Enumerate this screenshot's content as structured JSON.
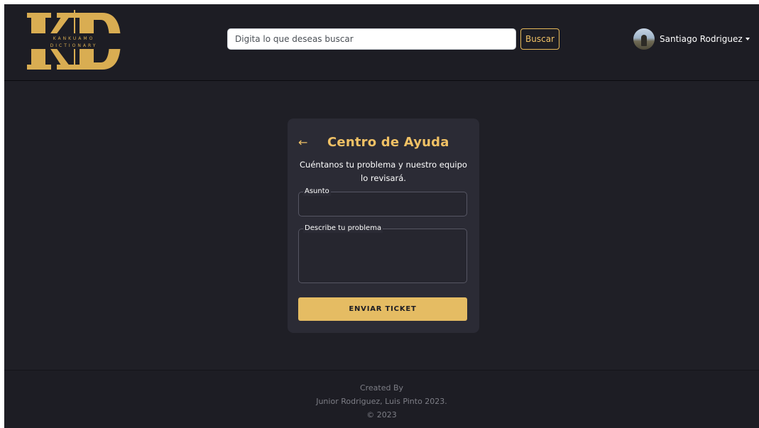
{
  "navbar": {
    "logo": {
      "letters": "KD",
      "line1": "KANKUAMO",
      "line2": "DICTIONARY",
      "color": "#d9ad52"
    },
    "search": {
      "placeholder": "Digita lo que deseas buscar",
      "value": "",
      "button_label": "Buscar",
      "icon": "none"
    },
    "user": {
      "name": "Santiago Rodriguez",
      "avatar_icon": "user-avatar-photo",
      "dropdown_icon": "caret-down-icon"
    }
  },
  "help_card": {
    "back_icon": "arrow-left-icon",
    "back_glyph": "←",
    "title": "Centro de Ayuda",
    "subtitle": "Cuéntanos tu problema y nuestro equipo lo revisará.",
    "fields": {
      "subject": {
        "label": "Asunto",
        "value": ""
      },
      "description": {
        "label": "Describe tu problema",
        "value": ""
      }
    },
    "submit_label": "ENVIAR TICKET"
  },
  "footer": {
    "line1": "Created By",
    "line2": "Junior Rodriguez, Luis Pinto 2023.",
    "line3": "© 2023"
  },
  "colors": {
    "background": "#1f1f26",
    "navbar": "#1d1d24",
    "card": "#2b2b35",
    "accent": "#e5bc63",
    "text": "#ffffff",
    "muted_text": "#7d7e86"
  }
}
